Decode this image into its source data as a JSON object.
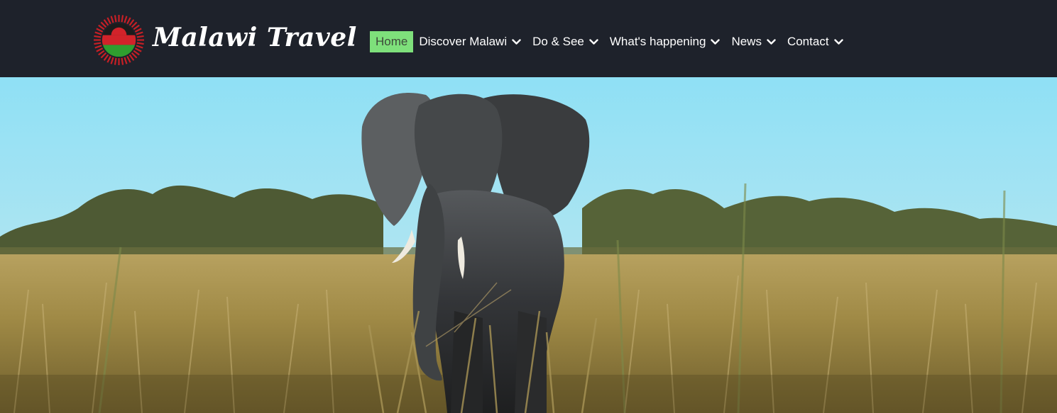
{
  "site": {
    "logo_text": "Malawi Travel",
    "flag_colors": {
      "black": "#1c1c1c",
      "red": "#d2232a",
      "green": "#2f9e2f",
      "rays": "#c81f25"
    }
  },
  "nav": {
    "items": [
      {
        "label": "Home",
        "active": true,
        "has_dropdown": false
      },
      {
        "label": "Discover Malawi",
        "active": false,
        "has_dropdown": true
      },
      {
        "label": "Do & See",
        "active": false,
        "has_dropdown": true
      },
      {
        "label": "What's happening",
        "active": false,
        "has_dropdown": true
      },
      {
        "label": "News",
        "active": false,
        "has_dropdown": true
      },
      {
        "label": "Contact",
        "active": false,
        "has_dropdown": true
      }
    ],
    "active_color": "#7ee07b",
    "chevron_icon": "chevron-down-icon"
  },
  "hero": {
    "subject": "elephant-in-grassland"
  }
}
